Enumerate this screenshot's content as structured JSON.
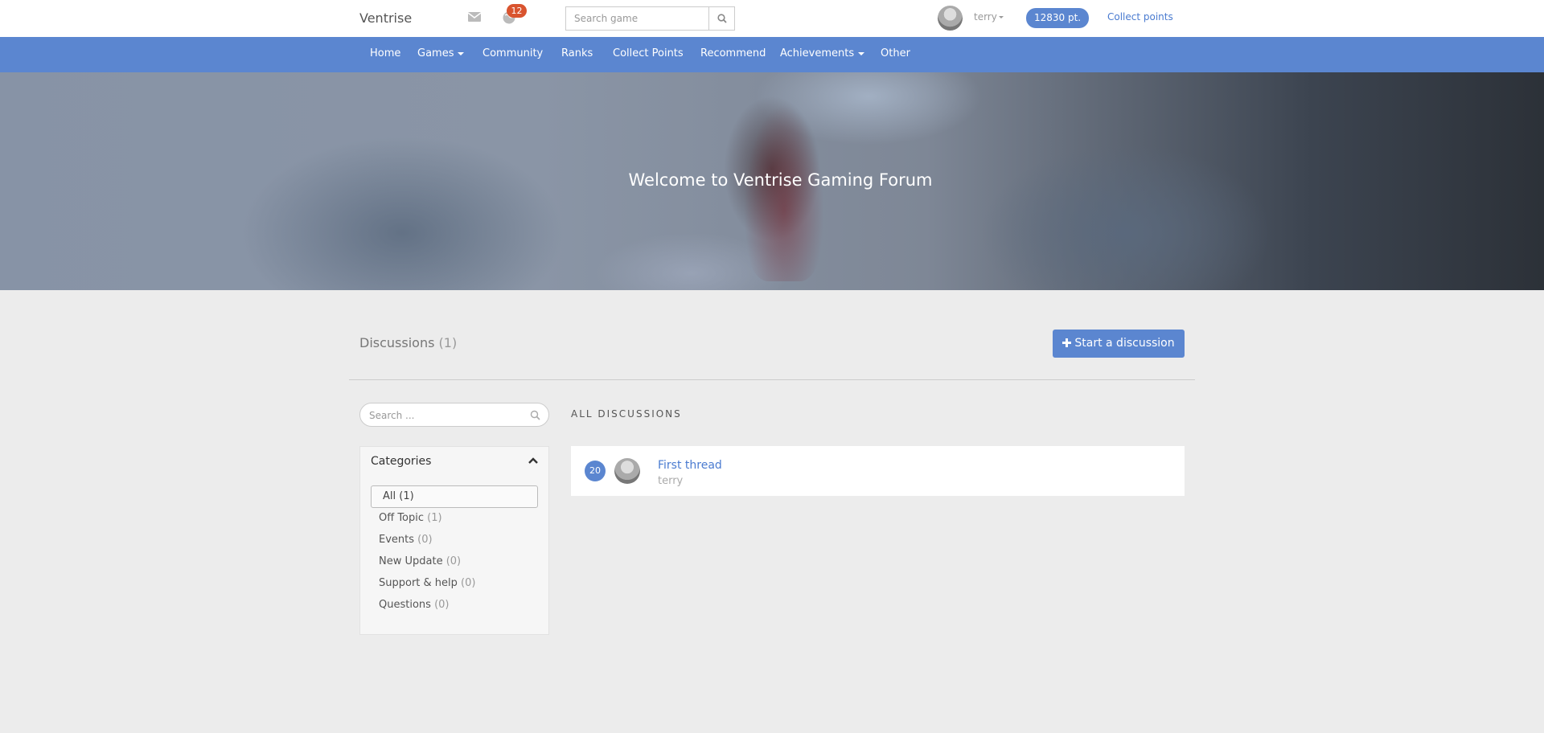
{
  "header": {
    "brand": "Ventrise",
    "notification_count": "12",
    "search_placeholder": "Search game",
    "username": "terry",
    "points": "12830 pt.",
    "collect_link": "Collect points"
  },
  "nav": {
    "items": [
      {
        "label": "Home"
      },
      {
        "label": "Games"
      },
      {
        "label": "Community"
      },
      {
        "label": "Ranks"
      },
      {
        "label": "Collect Points"
      },
      {
        "label": "Recommend"
      },
      {
        "label": "Achievements"
      },
      {
        "label": "Other"
      }
    ]
  },
  "hero": {
    "title": "Welcome to Ventrise Gaming Forum"
  },
  "discussions": {
    "title": "Discussions",
    "count": "(1)",
    "start_button": "Start a discussion",
    "section_label": "ALL DISCUSSIONS",
    "threads": [
      {
        "replies": "20",
        "title": "First thread",
        "author": "terry"
      }
    ]
  },
  "sidebar": {
    "search_placeholder": "Search ...",
    "categories_title": "Categories",
    "categories": [
      {
        "label": "All",
        "count": "(1)"
      },
      {
        "label": "Off Topic",
        "count": "(1)"
      },
      {
        "label": "Events",
        "count": "(0)"
      },
      {
        "label": "New Update",
        "count": "(0)"
      },
      {
        "label": "Support & help",
        "count": "(0)"
      },
      {
        "label": "Questions",
        "count": "(0)"
      }
    ]
  },
  "colors": {
    "accent": "#5b86d0",
    "badge": "#d9542f"
  }
}
